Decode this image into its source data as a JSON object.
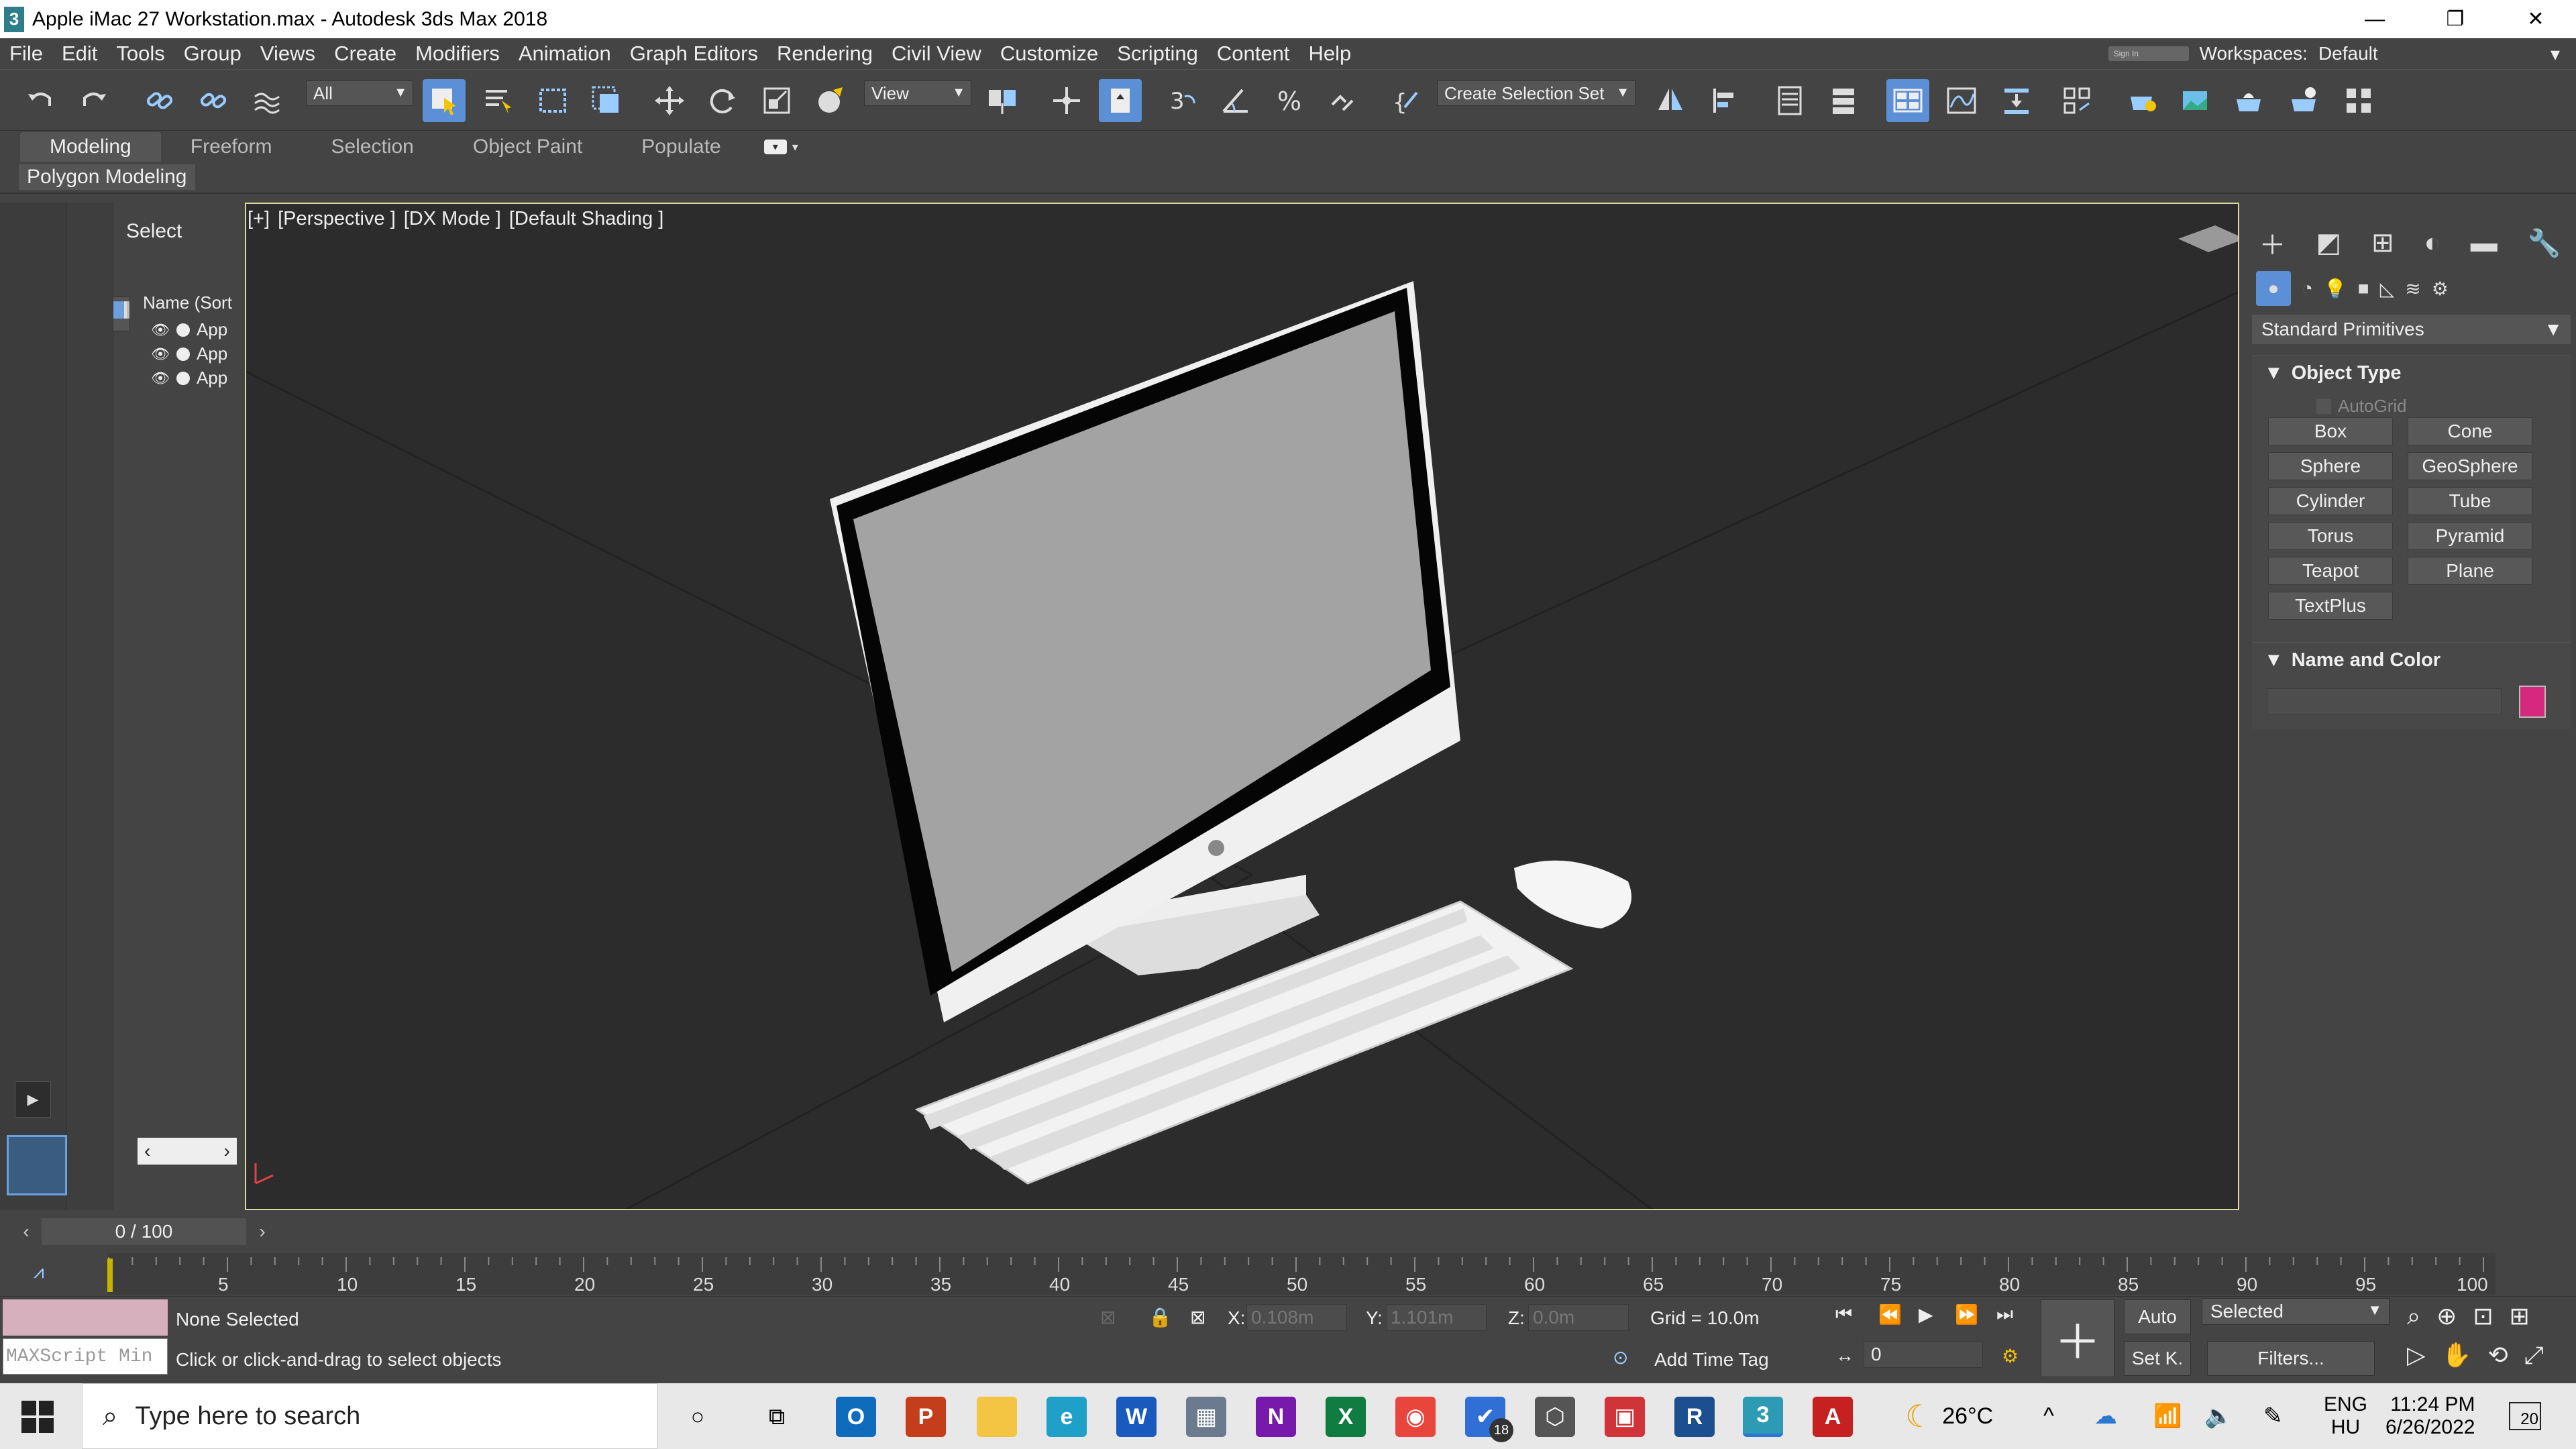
{
  "window": {
    "app_icon": "3",
    "title": "Apple iMac 27 Workstation.max - Autodesk 3ds Max 2018",
    "minimize": "—",
    "maximize": "❐",
    "close": "✕"
  },
  "menu": [
    "File",
    "Edit",
    "Tools",
    "Group",
    "Views",
    "Create",
    "Modifiers",
    "Animation",
    "Graph Editors",
    "Rendering",
    "Civil View",
    "Customize",
    "Scripting",
    "Content",
    "Help"
  ],
  "workspace": {
    "signin_label": "Sign In",
    "label": "Workspaces:",
    "value": "Default"
  },
  "toolbar": {
    "filter_value": "All",
    "refcoord_value": "View",
    "selection_set_value": "Create Selection Set",
    "snap_label": "3"
  },
  "ribbon": {
    "tabs": [
      "Modeling",
      "Freeform",
      "Selection",
      "Object Paint",
      "Populate"
    ],
    "sub_label": "Polygon Modeling"
  },
  "explorer": {
    "select_label": "Select",
    "name_header": "Name (Sort",
    "rows": [
      "App",
      "App",
      "App"
    ]
  },
  "viewport": {
    "label_plus": "[+]",
    "label_view": "[Perspective ]",
    "label_mode": "[DX Mode ]",
    "label_shading": "[Default Shading ]"
  },
  "command_panel": {
    "dropdown": "Standard Primitives",
    "object_type_title": "Object Type",
    "autogrid_label": "AutoGrid",
    "primitives": [
      "Box",
      "Cone",
      "Sphere",
      "GeoSphere",
      "Cylinder",
      "Tube",
      "Torus",
      "Pyramid",
      "Teapot",
      "Plane",
      "TextPlus"
    ],
    "name_color_title": "Name and Color",
    "object_color": "#d6287d"
  },
  "timeslider": {
    "frame_display": "0 / 100",
    "ticks": [
      "5",
      "10",
      "15",
      "20",
      "25",
      "30",
      "35",
      "40",
      "45",
      "50",
      "55",
      "60",
      "65",
      "70",
      "75",
      "80",
      "85",
      "90",
      "95",
      "100"
    ]
  },
  "status": {
    "maxscript_placeholder": "MAXScript Min",
    "selection_status": "None Selected",
    "prompt": "Click or click-and-drag to select objects",
    "x_label": "X:",
    "x_value": "0.108m",
    "y_label": "Y:",
    "y_value": "1.101m",
    "z_label": "Z:",
    "z_value": "0.0m",
    "grid": "Grid = 10.0m",
    "add_time_tag": "Add Time Tag",
    "auto_label": "Auto",
    "setkey_label": "Set K.",
    "key_filter_value": "Selected",
    "filters_label": "Filters...",
    "current_frame": "0"
  },
  "taskbar": {
    "search_placeholder": "Type here to search",
    "badge_count": "18",
    "weather": "26°C",
    "lang_top": "ENG",
    "lang_bottom": "HU",
    "time": "11:24 PM",
    "date": "6/26/2022",
    "notif_count": "20",
    "apps": [
      {
        "label": "O",
        "color": "#0f6cbd"
      },
      {
        "label": "P",
        "color": "#c43e1c"
      },
      {
        "label": "",
        "color": "#f4c542"
      },
      {
        "label": "e",
        "color": "#1fa0c8"
      },
      {
        "label": "W",
        "color": "#185abd"
      },
      {
        "label": "▦",
        "color": "#6b7a8f"
      },
      {
        "label": "N",
        "color": "#7719aa"
      },
      {
        "label": "X",
        "color": "#107c41"
      },
      {
        "label": "◉",
        "color": "#e8453c"
      },
      {
        "label": "✔",
        "color": "#2f6fd6"
      },
      {
        "label": "⬡",
        "color": "#555"
      },
      {
        "label": "▣",
        "color": "#d13438"
      },
      {
        "label": "R",
        "color": "#1b4f8f"
      },
      {
        "label": "3",
        "color": "#2e9bb5"
      },
      {
        "label": "A",
        "color": "#c62020"
      }
    ]
  }
}
